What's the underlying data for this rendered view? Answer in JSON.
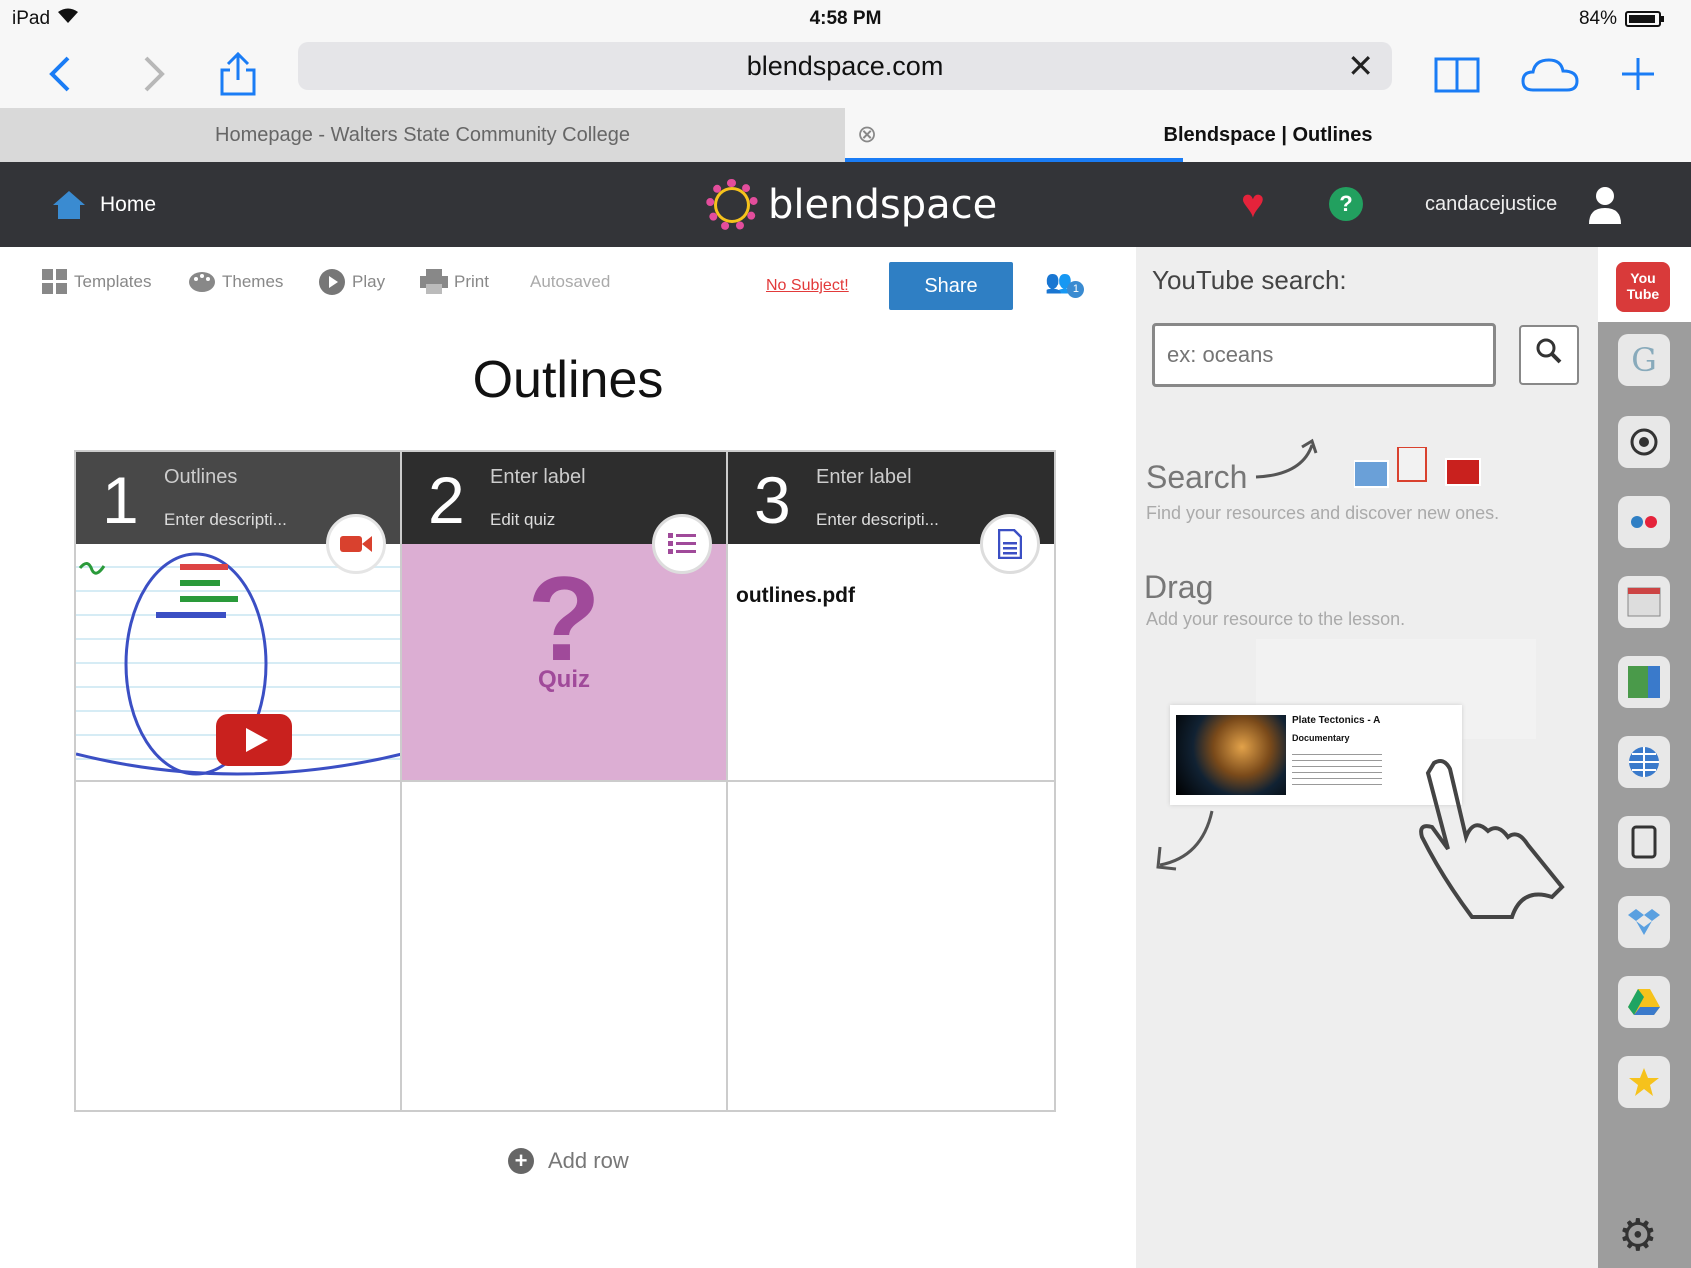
{
  "status": {
    "device": "iPad",
    "time": "4:58 PM",
    "battery": "84%"
  },
  "browser": {
    "url": "blendspace.com",
    "tabs": [
      {
        "title": "Homepage - Walters State Community College",
        "active": false
      },
      {
        "title": "Blendspace | Outlines",
        "active": true
      }
    ]
  },
  "header": {
    "home_label": "Home",
    "logo_text": "blendspace",
    "username": "candacejustice"
  },
  "editor_toolbar": {
    "templates": "Templates",
    "themes": "Themes",
    "play": "Play",
    "print": "Print",
    "autosaved": "Autosaved",
    "no_subject": "No Subject!",
    "share": "Share",
    "collaborators": "1"
  },
  "lesson": {
    "title": "Outlines",
    "tiles": [
      {
        "number": "1",
        "label": "Outlines",
        "description": "Enter descripti...",
        "type": "video"
      },
      {
        "number": "2",
        "label": "Enter label",
        "description": "Edit quiz",
        "type": "quiz",
        "body": "Quiz"
      },
      {
        "number": "3",
        "label": "Enter label",
        "description": "Enter descripti...",
        "type": "document",
        "file": "outlines.pdf"
      }
    ],
    "add_row": "Add row"
  },
  "panel": {
    "title": "YouTube search:",
    "search_placeholder": "ex: oceans",
    "search_heading": "Search",
    "search_text": "Find your resources and discover new ones.",
    "drag_heading": "Drag",
    "drag_text": "Add your resource to the lesson.",
    "sample_title": "Plate Tectonics - A",
    "sample_subtitle": "Documentary"
  },
  "rail": {
    "youtube_label": "You Tube",
    "google_label": "G"
  },
  "colors": {
    "header_bg": "#333438",
    "share_button": "#2f7fc4",
    "quiz_tile": "#dcaed3",
    "link_blue": "#1a7cf5"
  }
}
